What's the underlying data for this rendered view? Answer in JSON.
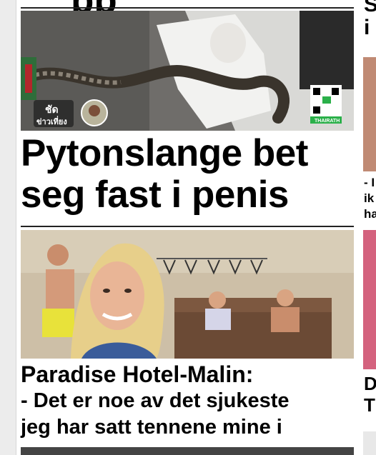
{
  "main": {
    "article1": {
      "headline": "Pytonslange bet\nseg fast i penis",
      "image_overlay": {
        "logo_text_top": "ชัด",
        "logo_text_bottom": "ข่าวเที่ยง",
        "qr_caption": "THAIRATH"
      }
    },
    "article2": {
      "headline_title": "Paradise Hotel-Malin:",
      "headline_quote": "- Det er noe av det sjukeste\njeg har satt tennene mine i"
    }
  },
  "right_column": {
    "letter_top": "S",
    "letter_second": "i",
    "snippet": "- I\nik\nha",
    "letter_d": "D",
    "letter_t": "T"
  }
}
